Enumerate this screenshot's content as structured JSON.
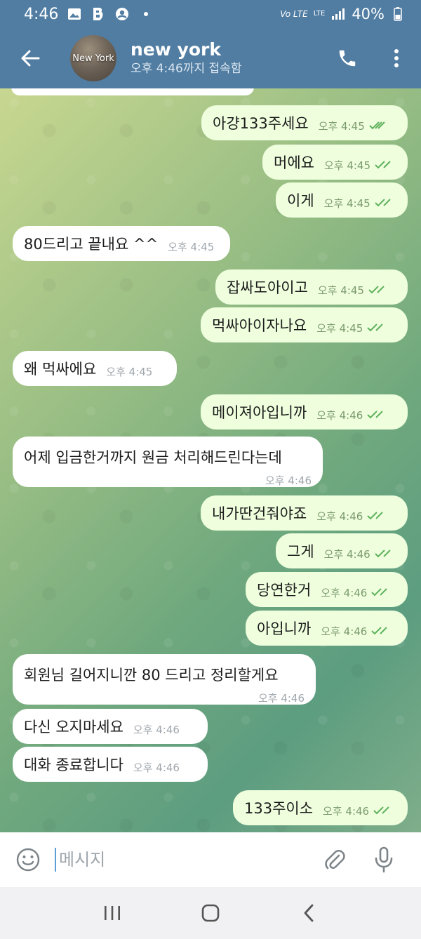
{
  "status_bar": {
    "time": "4:46",
    "network": "Vo LTE",
    "lte": "LTE",
    "battery": "40%"
  },
  "header": {
    "title": "new york",
    "subtitle": "오후 4:46까지 접속함",
    "avatar_text": "New York"
  },
  "messages": [
    {
      "dir": "out",
      "text": "아걍133주세요",
      "time": "오후 4:45",
      "read": true
    },
    {
      "dir": "out",
      "text": "머에요",
      "time": "오후 4:45",
      "read": true
    },
    {
      "dir": "out",
      "text": "이게",
      "time": "오후 4:45",
      "read": true
    },
    {
      "dir": "in",
      "text": "80드리고 끝내요 ^^",
      "time": "오후 4:45"
    },
    {
      "dir": "out",
      "text": "잡싸도아이고",
      "time": "오후 4:45",
      "read": true
    },
    {
      "dir": "out",
      "text": "먹싸아이자나요",
      "time": "오후 4:45",
      "read": true
    },
    {
      "dir": "in",
      "text": "왜 먹싸에요",
      "time": "오후 4:45"
    },
    {
      "dir": "out",
      "text": "메이져아입니까",
      "time": "오후 4:46",
      "read": true
    },
    {
      "dir": "in",
      "text": "어제 입금한거까지 원금 처리해드린다는데",
      "time": "오후 4:46"
    },
    {
      "dir": "out",
      "text": "내가딴건줘야죠",
      "time": "오후 4:46",
      "read": true
    },
    {
      "dir": "out",
      "text": "그게",
      "time": "오후 4:46",
      "read": true
    },
    {
      "dir": "out",
      "text": "당연한거",
      "time": "오후 4:46",
      "read": true
    },
    {
      "dir": "out",
      "text": "아입니까",
      "time": "오후 4:46",
      "read": true
    },
    {
      "dir": "in",
      "text": "회원님 길어지니깐 80 드리고 정리할게요",
      "time": "오후 4:46"
    },
    {
      "dir": "in",
      "text": "다신 오지마세요",
      "time": "오후 4:46"
    },
    {
      "dir": "in",
      "text": "대화 종료합니다",
      "time": "오후 4:46"
    },
    {
      "dir": "out",
      "text": "133주이소",
      "time": "오후 4:46",
      "read": true
    }
  ],
  "composer": {
    "placeholder": "메시지"
  },
  "colors": {
    "header_bg": "#517da2",
    "outgoing_bubble": "#efffde",
    "incoming_bubble": "#ffffff",
    "check_color": "#5fb25d"
  },
  "icons": {
    "back": "arrow-left-icon",
    "call": "phone-icon",
    "menu": "more-vertical-icon",
    "emoji": "smile-icon",
    "attach": "paperclip-icon",
    "mic": "microphone-icon"
  }
}
